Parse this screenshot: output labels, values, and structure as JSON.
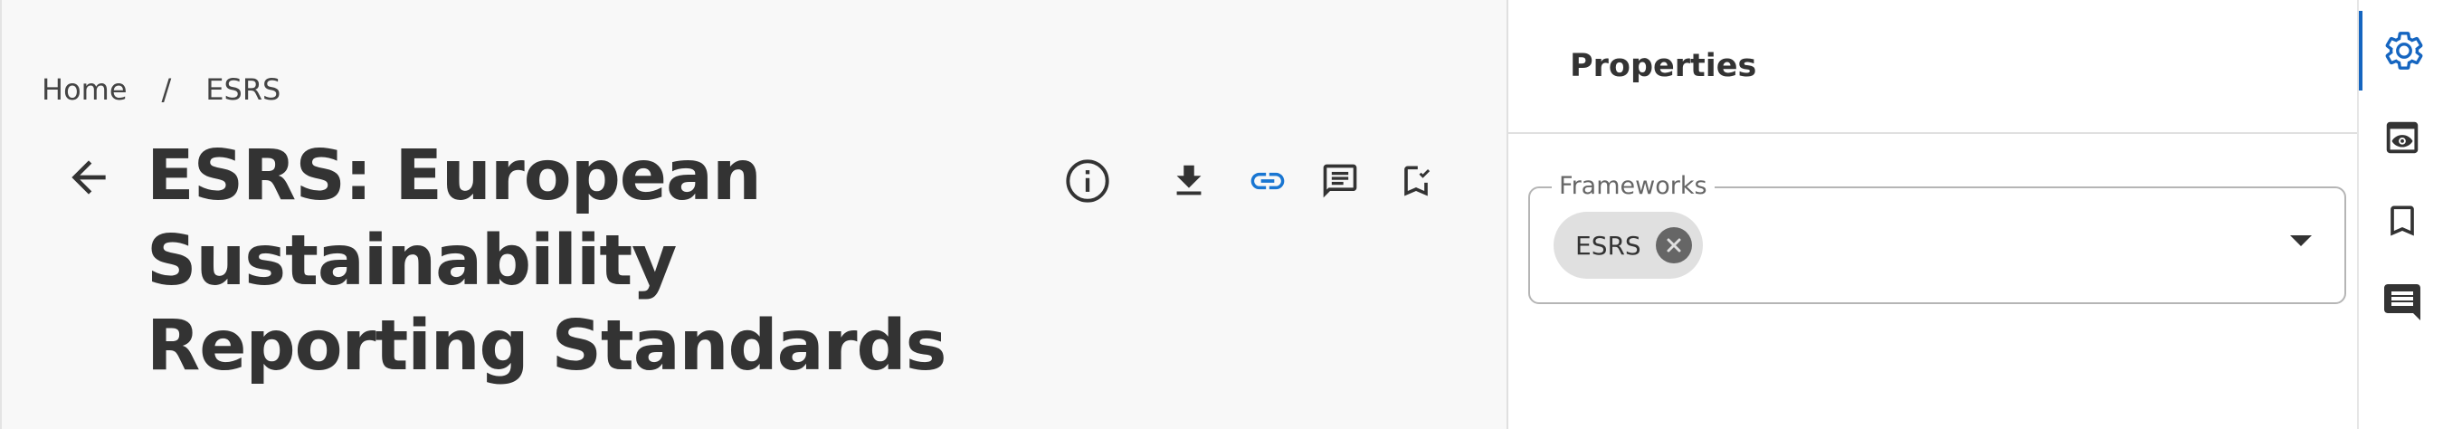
{
  "breadcrumb": {
    "items": [
      {
        "label": "Home"
      },
      {
        "label": "ESRS"
      }
    ],
    "separator": "/"
  },
  "page": {
    "title": "ESRS: European Sustainability Reporting Standards"
  },
  "toolbar": {
    "icons": [
      "info-icon",
      "download-icon",
      "link-icon",
      "notes-icon",
      "bookmark-check-icon"
    ],
    "link_color": "#1976d2"
  },
  "properties_panel": {
    "title": "Properties",
    "frameworks_field": {
      "label": "Frameworks",
      "chips": [
        {
          "label": "ESRS"
        }
      ]
    }
  },
  "right_rail": {
    "items": [
      "settings-icon",
      "preview-icon",
      "bookmark-icon",
      "comment-icon"
    ],
    "active_item": "settings-icon",
    "accent_color": "#1565c0"
  }
}
